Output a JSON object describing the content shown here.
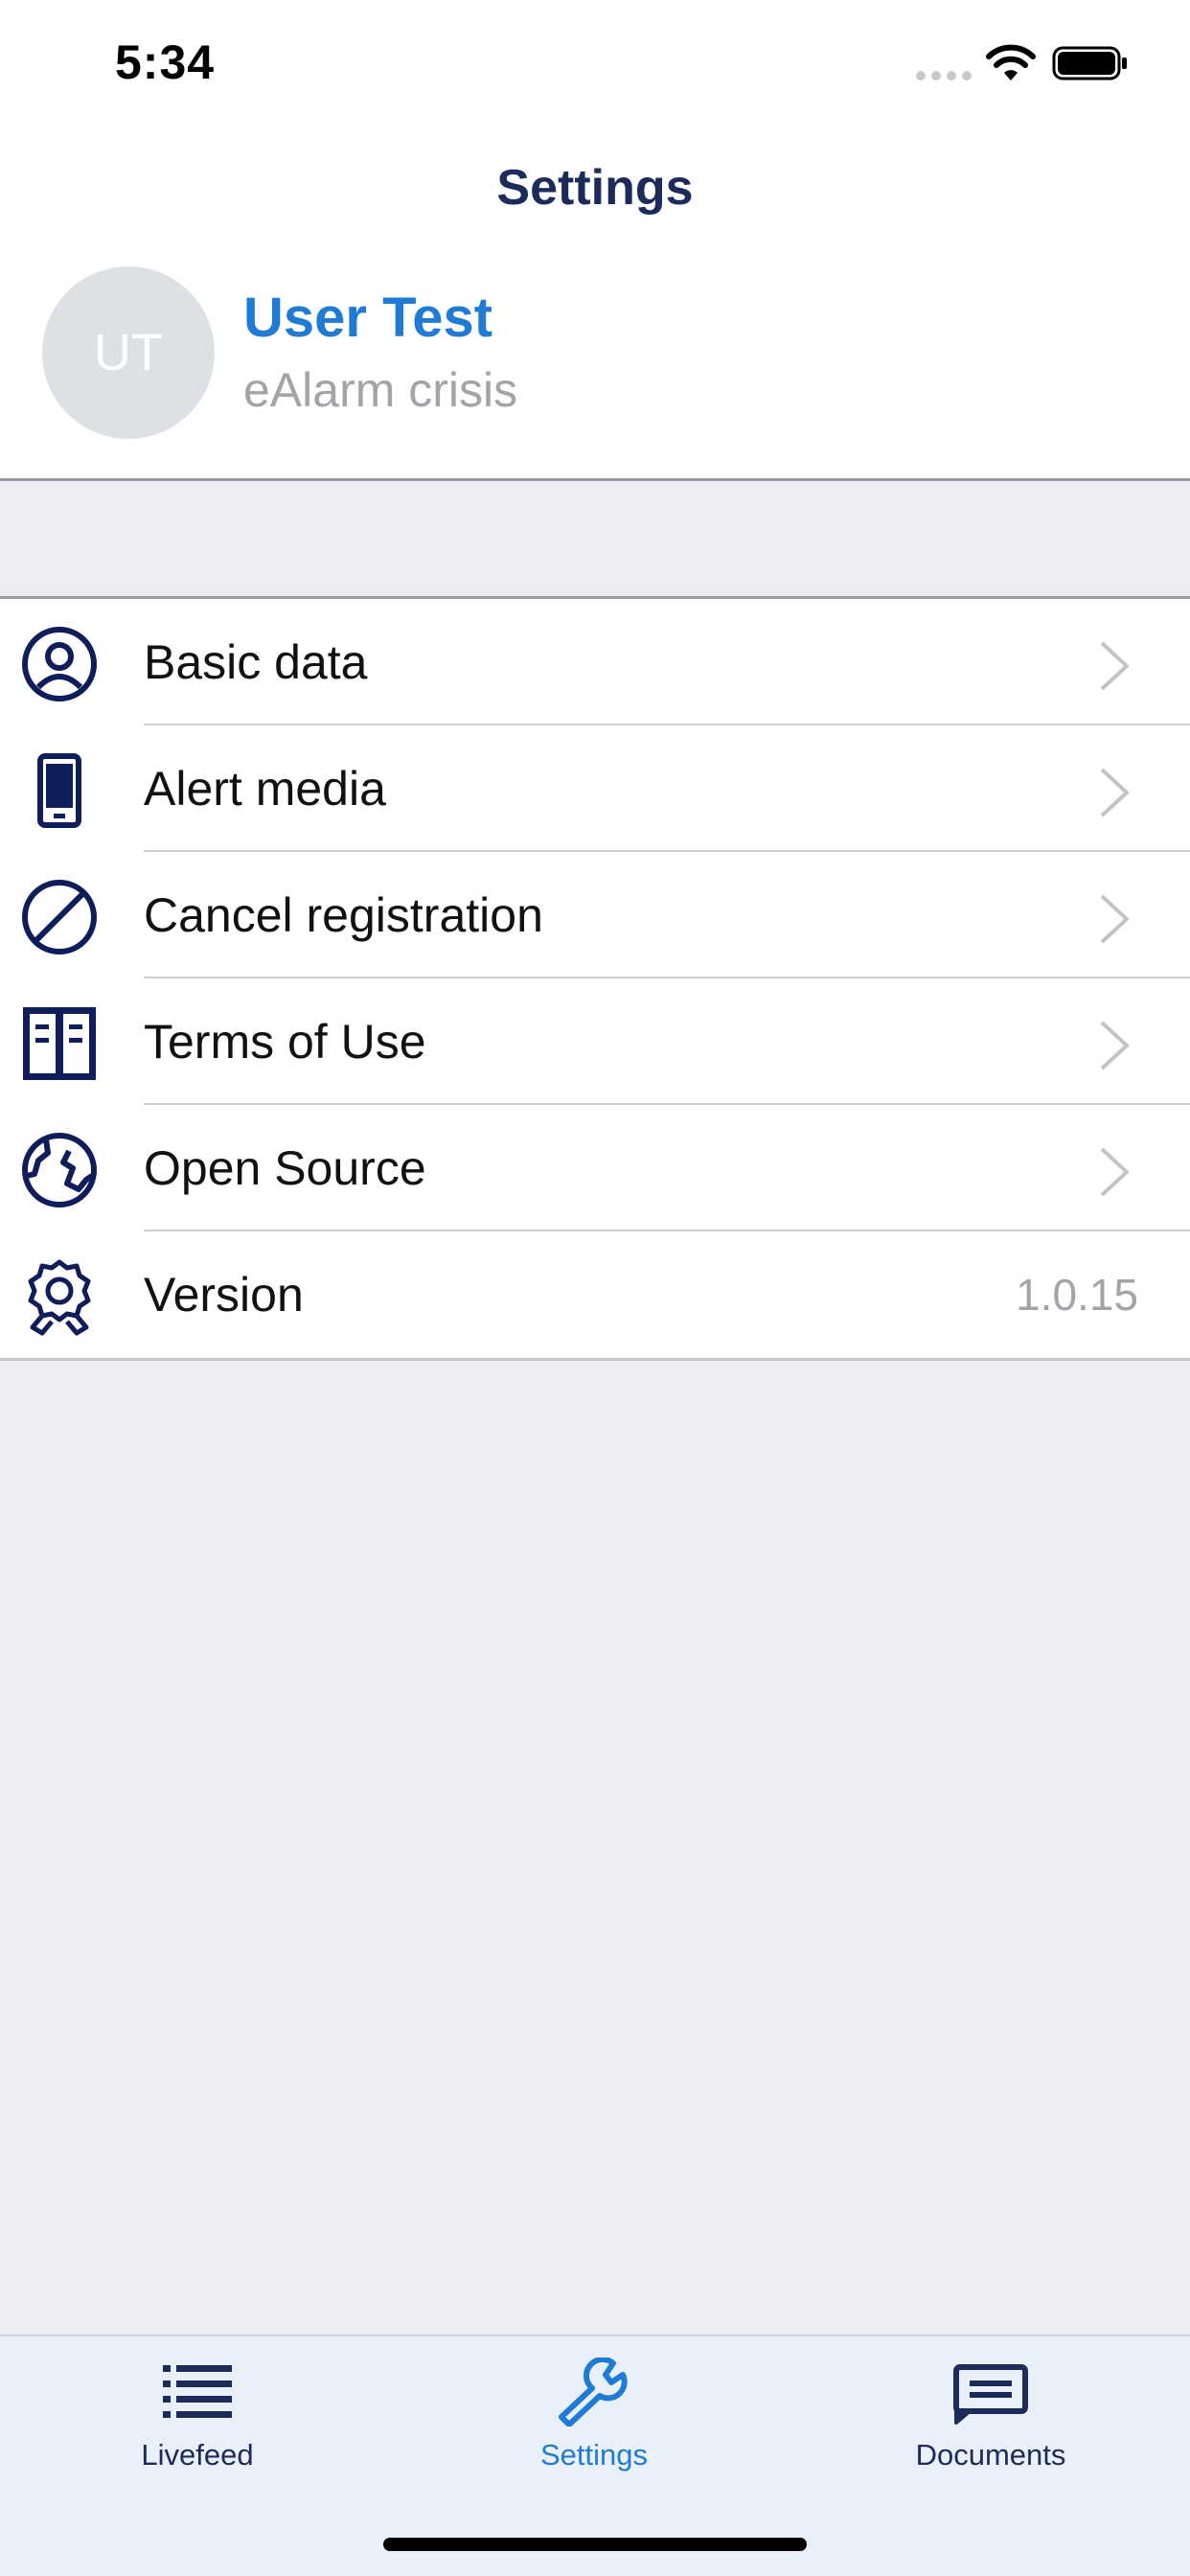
{
  "status_bar": {
    "time": "5:34"
  },
  "header": {
    "title": "Settings",
    "avatar_initials": "UT",
    "user_name": "User Test",
    "user_subtitle": "eAlarm crisis"
  },
  "menu": {
    "items": [
      {
        "label": "Basic data",
        "icon": "user-circle-icon"
      },
      {
        "label": "Alert media",
        "icon": "smartphone-icon"
      },
      {
        "label": "Cancel registration",
        "icon": "prohibited-icon"
      },
      {
        "label": "Terms of Use",
        "icon": "book-icon"
      },
      {
        "label": "Open Source",
        "icon": "globe-icon"
      },
      {
        "label": "Version",
        "icon": "badge-icon",
        "value": "1.0.15"
      }
    ]
  },
  "tabbar": {
    "tabs": [
      {
        "label": "Livefeed",
        "icon": "list-icon",
        "active": false
      },
      {
        "label": "Settings",
        "icon": "wrench-icon",
        "active": true
      },
      {
        "label": "Documents",
        "icon": "message-icon",
        "active": false
      }
    ]
  },
  "colors": {
    "accent": "#1F7BD3",
    "navy": "#1C2B5A",
    "icon": "#0F1D5A",
    "background": "#ECECF2",
    "tabbar_background": "#E9F0FA"
  }
}
